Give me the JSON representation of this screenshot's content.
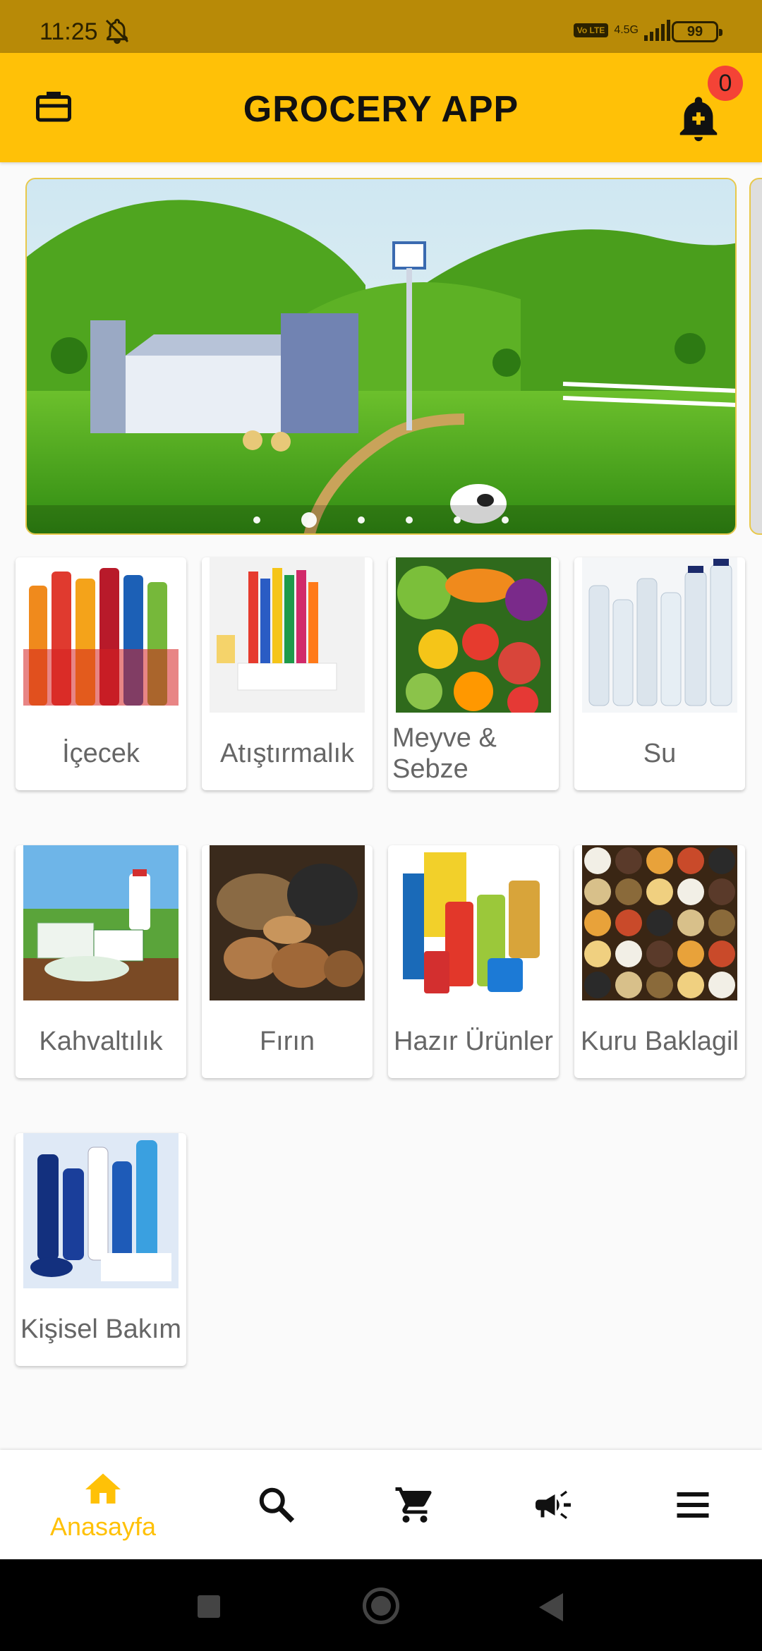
{
  "status_bar": {
    "time": "11:25",
    "network": "4.5G",
    "volte": "Vo LTE",
    "battery": "99"
  },
  "app_bar": {
    "title": "GROCERY APP",
    "notification_count": "0"
  },
  "carousel": {
    "slide_count": 6,
    "active_index": 1
  },
  "categories": [
    {
      "label": "İçecek"
    },
    {
      "label": "Atıştırmalık"
    },
    {
      "label": "Meyve & Sebze"
    },
    {
      "label": "Su"
    },
    {
      "label": "Kahvaltılık"
    },
    {
      "label": "Fırın"
    },
    {
      "label": "Hazır Ürünler"
    },
    {
      "label": "Kuru Baklagil"
    },
    {
      "label": "Kişisel Bakım"
    }
  ],
  "bottom_nav": {
    "items": [
      {
        "icon": "home-icon",
        "label": "Anasayfa",
        "active": true
      },
      {
        "icon": "search-icon",
        "label": ""
      },
      {
        "icon": "cart-icon",
        "label": ""
      },
      {
        "icon": "megaphone-icon",
        "label": ""
      },
      {
        "icon": "menu-icon",
        "label": ""
      }
    ]
  },
  "colors": {
    "primary": "#ffc107",
    "status_bar": "#b88a07",
    "badge": "#f44336"
  }
}
